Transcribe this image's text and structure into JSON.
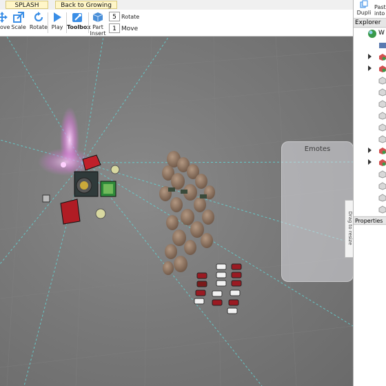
{
  "tabs": [
    {
      "label": "SPLASH"
    },
    {
      "label": "Back to Growing Up"
    }
  ],
  "toolbar": {
    "move_label": "ove",
    "scale_label": "Scale",
    "rotate_label": "Rotate",
    "play_label": "Play",
    "toolbox_label": "Toolbox",
    "part_label": "Part",
    "insert_label": "Insert",
    "rotate_increment": "5",
    "rotate_increment_label": "Rotate",
    "move_increment": "1",
    "move_increment_label": "Move"
  },
  "right_panel": {
    "duplicate_label": "Dupli",
    "paste_label": "Paste",
    "paste_label_2": "into",
    "explorer_title": "Explorer",
    "workspace_label": "W",
    "properties_title": "Properties"
  },
  "viewport": {
    "emotes_title": "Emotes",
    "drag_to_resize": "Drag to resize"
  },
  "colors": {
    "accent": "#3a8ee6",
    "tab_background": "#fff6c8",
    "viewport_grid": "#8a8a8a"
  }
}
